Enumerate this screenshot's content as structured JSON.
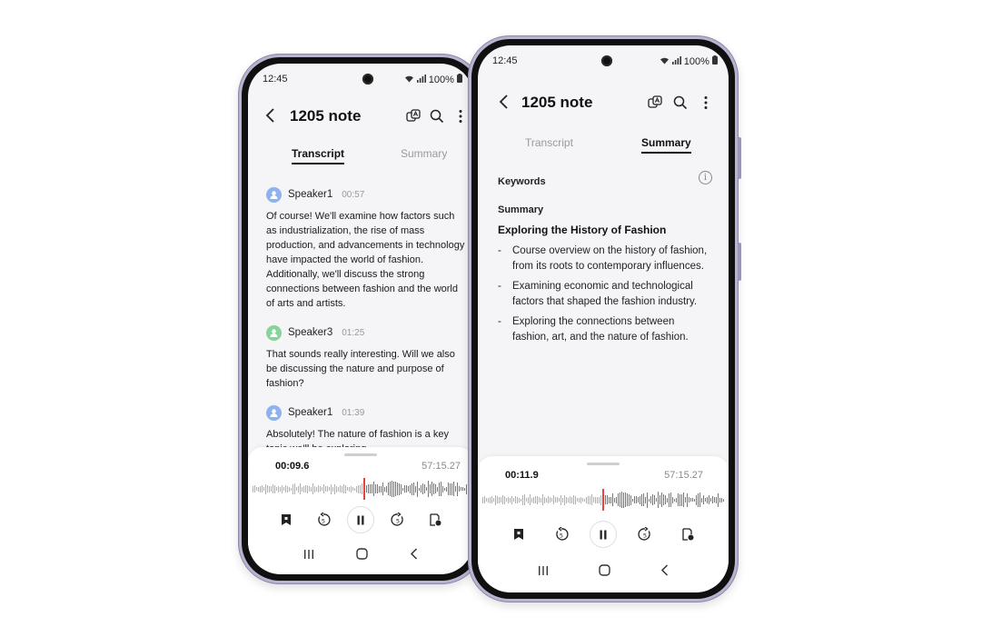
{
  "status_bar": {
    "time": "12:45",
    "battery": "100%"
  },
  "app_bar": {
    "title": "1205 note"
  },
  "tabs": {
    "transcript": "Transcript",
    "summary": "Summary"
  },
  "transcript": [
    {
      "speaker": "Speaker1",
      "time": "00:57",
      "avatar_color": "#8db2ef",
      "text": "Of course! We'll examine how factors such as industrialization, the rise of mass production, and advancements in technology have impacted the world of fashion. Additionally, we'll discuss the strong connections between fashion and the world of arts and artists."
    },
    {
      "speaker": "Speaker3",
      "time": "01:25",
      "avatar_color": "#86d49b",
      "text": "That sounds really interesting. Will we also be discussing the nature and purpose of fashion?"
    },
    {
      "speaker": "Speaker1",
      "time": "01:39",
      "avatar_color": "#8db2ef",
      "text": "Absolutely! The nature of fashion is a key topic we'll be exploring."
    }
  ],
  "summary": {
    "keywords_label": "Keywords",
    "section_label": "Summary",
    "heading": "Exploring the History of Fashion",
    "bullet_marker": "-",
    "bullets": [
      "Course overview on the history of fashion, from its roots to contemporary influences.",
      "Examining economic and technological factors that shaped the fashion industry.",
      "Exploring the connections between fashion, art, and the nature of fashion."
    ]
  },
  "player_left": {
    "current": "00:09.6",
    "total": "57:15.27",
    "progress": 0.52
  },
  "player_right": {
    "current": "00:11.9",
    "total": "57:15.27",
    "progress": 0.5
  },
  "colors": {
    "accent_cursor": "#e2453c",
    "phone_frame": "#b9b3cf",
    "screen_bg": "#f5f5f7"
  },
  "icons": {
    "app_bar": [
      "back-icon",
      "translate-icon",
      "search-icon",
      "more-vert-icon"
    ],
    "player": [
      "bookmark-icon",
      "rewind-5-icon",
      "pause-icon",
      "forward-5-icon",
      "note-add-icon"
    ],
    "nav": [
      "recents-icon",
      "home-icon",
      "back-nav-icon"
    ]
  }
}
